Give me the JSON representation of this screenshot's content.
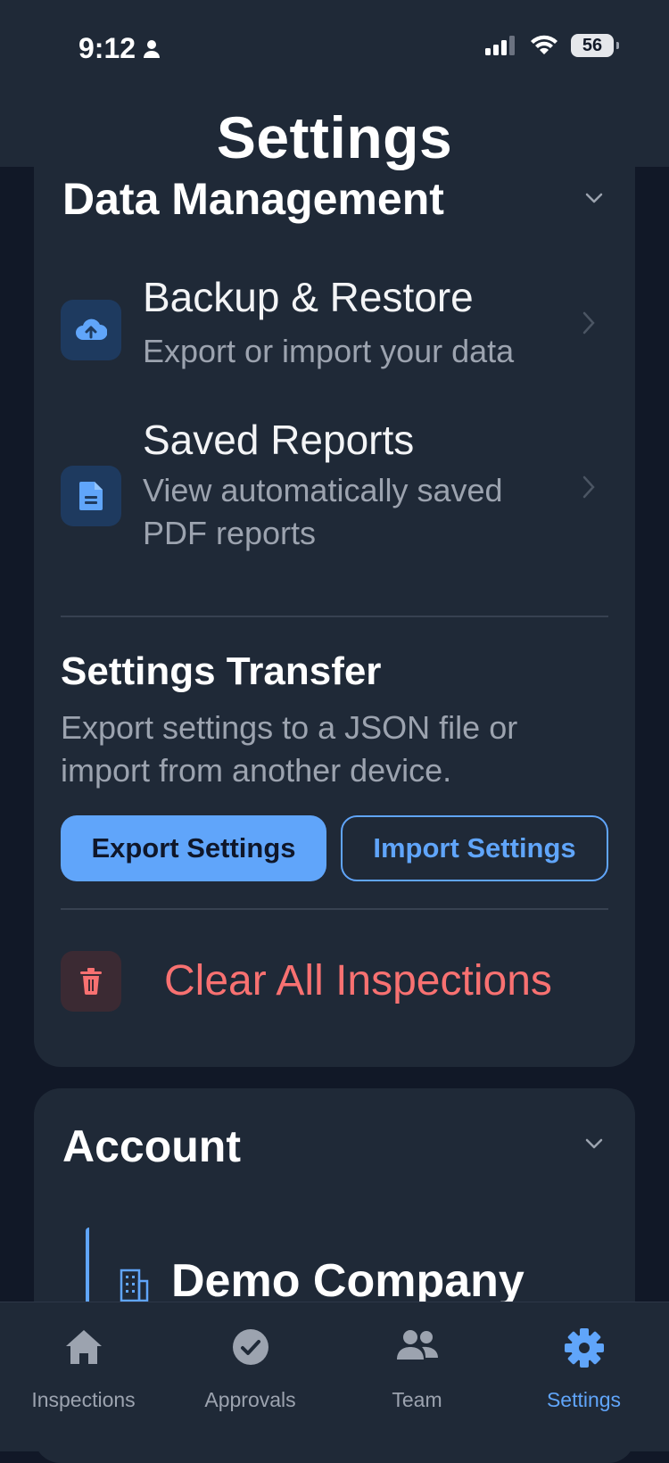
{
  "status_bar": {
    "time": "9:12",
    "battery": "56"
  },
  "header": {
    "title": "Settings"
  },
  "data_management": {
    "title": "Data Management",
    "items": [
      {
        "title": "Backup & Restore",
        "subtitle": "Export or import your data",
        "icon": "cloud-upload-icon"
      },
      {
        "title": "Saved Reports",
        "subtitle": "View automatically saved PDF reports",
        "icon": "document-icon"
      }
    ],
    "transfer": {
      "title": "Settings Transfer",
      "description": "Export settings to a JSON file or import from another device.",
      "export_label": "Export Settings",
      "import_label": "Import Settings"
    },
    "danger": {
      "label": "Clear All Inspections",
      "icon": "trash-icon"
    }
  },
  "account": {
    "title": "Account",
    "company": "Demo Company"
  },
  "tabbar": {
    "tabs": [
      {
        "label": "Inspections",
        "icon": "home-icon"
      },
      {
        "label": "Approvals",
        "icon": "check-circle-icon"
      },
      {
        "label": "Team",
        "icon": "team-icon"
      },
      {
        "label": "Settings",
        "icon": "gear-icon",
        "active": true
      }
    ]
  },
  "colors": {
    "accent": "#60a5fa",
    "danger": "#f87171",
    "card": "#1f2937",
    "background": "#111827"
  }
}
